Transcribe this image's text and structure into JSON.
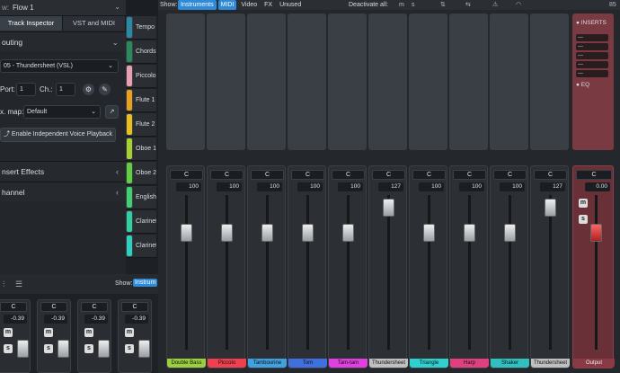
{
  "inspector": {
    "flow_label": "Flow 1",
    "tabs": [
      "Track Inspector",
      "VST and MIDI"
    ],
    "routing_label": "outing",
    "instrument": "05 - Thundersheet (VSL)",
    "port_label": "Port:",
    "port_value": "1",
    "ch_label": "Ch.:",
    "ch_value": "1",
    "exmap_label": "x. map:",
    "exmap_value": "Default",
    "voice_button": "Enable Independent Voice Playback",
    "insert_effects": "nsert Effects",
    "channel": "hannel"
  },
  "staff": [
    {
      "label": "Tempo",
      "color": "#2a8aa6"
    },
    {
      "label": "Chords",
      "color": "#2a8a5a"
    },
    {
      "label": "Piccolo",
      "color": "#e8a0b0"
    },
    {
      "label": "Flute 1",
      "color": "#e8a020"
    },
    {
      "label": "Flute 2",
      "color": "#e8c020"
    },
    {
      "label": "Oboe 1",
      "color": "#a8d030"
    },
    {
      "label": "Oboe 2",
      "color": "#60d040"
    },
    {
      "label": "English",
      "color": "#40d070"
    },
    {
      "label": "Clarinet",
      "color": "#30d0a0"
    },
    {
      "label": "Clarinet",
      "color": "#30d0c0"
    }
  ],
  "mixer_top": {
    "show_label": "Show:",
    "filters": [
      "Instruments",
      "MIDI",
      "Video",
      "FX",
      "Unused"
    ],
    "deactivate_label": "Deactivate all:",
    "page_num": "85"
  },
  "channels": [
    {
      "name": "Double Bass",
      "pan": "C",
      "volume": "100",
      "color": "#9ad040"
    },
    {
      "name": "Piccolo",
      "pan": "C",
      "volume": "100",
      "color": "#f04050"
    },
    {
      "name": "Tambourine",
      "pan": "C",
      "volume": "100",
      "color": "#40a0e0"
    },
    {
      "name": "Tom",
      "pan": "C",
      "volume": "100",
      "color": "#4070e0"
    },
    {
      "name": "Tam-tam",
      "pan": "C",
      "volume": "100",
      "color": "#e040e0"
    },
    {
      "name": "Thundersheet",
      "pan": "C",
      "volume": "127",
      "color": "#bfbfbf"
    },
    {
      "name": "Triangle",
      "pan": "C",
      "volume": "100",
      "color": "#30d0d0"
    },
    {
      "name": "Harp",
      "pan": "C",
      "volume": "100",
      "color": "#e04080"
    },
    {
      "name": "Shaker",
      "pan": "C",
      "volume": "100",
      "color": "#30c0c0"
    },
    {
      "name": "Thundersheet",
      "pan": "C",
      "volume": "127",
      "color": "#bfbfbf"
    }
  ],
  "output": {
    "name": "Output",
    "pan": "C",
    "volume": "0.00",
    "inserts_label": "INSERTS",
    "eq_label": "EQ",
    "insert_slots": [
      "---",
      "---",
      "---",
      "---",
      "---"
    ]
  },
  "bottom": {
    "show_label": "Show:",
    "instruments_filter": "Instrum",
    "strips": [
      {
        "pan": "C",
        "volume": "-0.39"
      },
      {
        "pan": "C",
        "volume": "-0.39"
      },
      {
        "pan": "C",
        "volume": "-0.39"
      },
      {
        "pan": "C",
        "volume": "-0.39"
      }
    ]
  }
}
